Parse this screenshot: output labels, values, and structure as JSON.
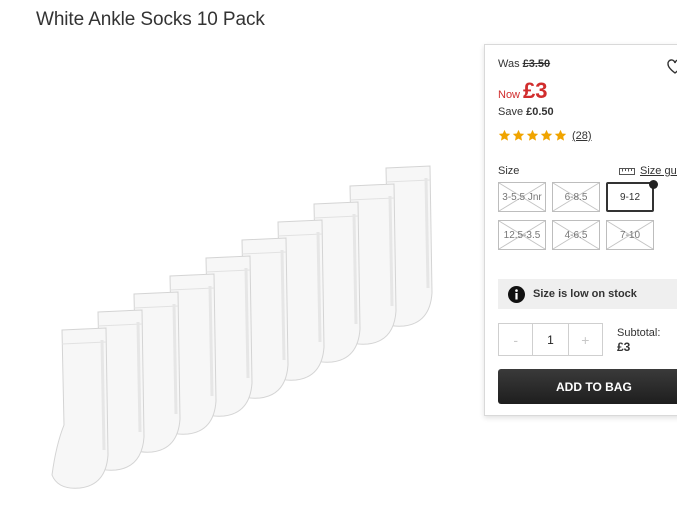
{
  "product": {
    "title": "White Ankle Socks 10 Pack",
    "image_icon": "socks-product-image"
  },
  "pricing": {
    "was_label": "Was",
    "was_value": "£3.50",
    "now_label": "Now",
    "now_value": "£3",
    "save_label": "Save",
    "save_value": "£0.50",
    "accent_color": "#d12d2d"
  },
  "rating": {
    "stars": 5,
    "max_stars": 5,
    "count": "(28)",
    "star_color": "#f0a400"
  },
  "sizes": {
    "label": "Size",
    "guide_label": "Size gui",
    "options": [
      {
        "label": "3-5.5 Jnr",
        "available": false,
        "selected": false
      },
      {
        "label": "6-8.5",
        "available": false,
        "selected": false
      },
      {
        "label": "9-12",
        "available": true,
        "selected": true
      },
      {
        "label": "12.5-3.5",
        "available": false,
        "selected": false
      },
      {
        "label": "4-6.5",
        "available": false,
        "selected": false
      },
      {
        "label": "7-10",
        "available": false,
        "selected": false
      }
    ]
  },
  "stock": {
    "message": "Size is low on stock",
    "icon": "info-icon"
  },
  "quantity": {
    "minus": "-",
    "value": "1",
    "plus": "+"
  },
  "subtotal": {
    "label": "Subtotal:",
    "value": "£3"
  },
  "actions": {
    "add_to_bag": "ADD TO BAG"
  }
}
